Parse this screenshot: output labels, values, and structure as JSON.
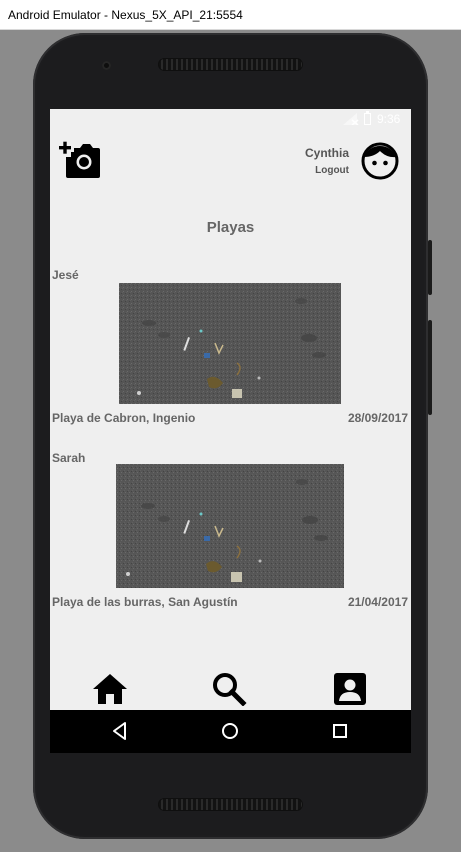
{
  "window": {
    "title": "Android Emulator - Nexus_5X_API_21:5554"
  },
  "status_bar": {
    "time": "9:36"
  },
  "header": {
    "add_photo_icon": "add-photo-camera-icon",
    "user_name": "Cynthia",
    "logout_label": "Logout",
    "avatar_icon": "face-icon"
  },
  "page": {
    "title": "Playas"
  },
  "posts": [
    {
      "user": "Jesé",
      "place": "Playa de Cabron, Ingenio",
      "date": "28/09/2017"
    },
    {
      "user": "Sarah",
      "place": "Playa de las burras, San Agustín",
      "date": "21/04/2017"
    }
  ],
  "bottom_nav": {
    "items": [
      {
        "icon": "home-icon"
      },
      {
        "icon": "search-icon"
      },
      {
        "icon": "account-box-icon"
      }
    ]
  },
  "system_nav": {
    "back_icon": "back-triangle-icon",
    "home_icon": "home-circle-icon",
    "recents_icon": "recents-square-icon"
  }
}
